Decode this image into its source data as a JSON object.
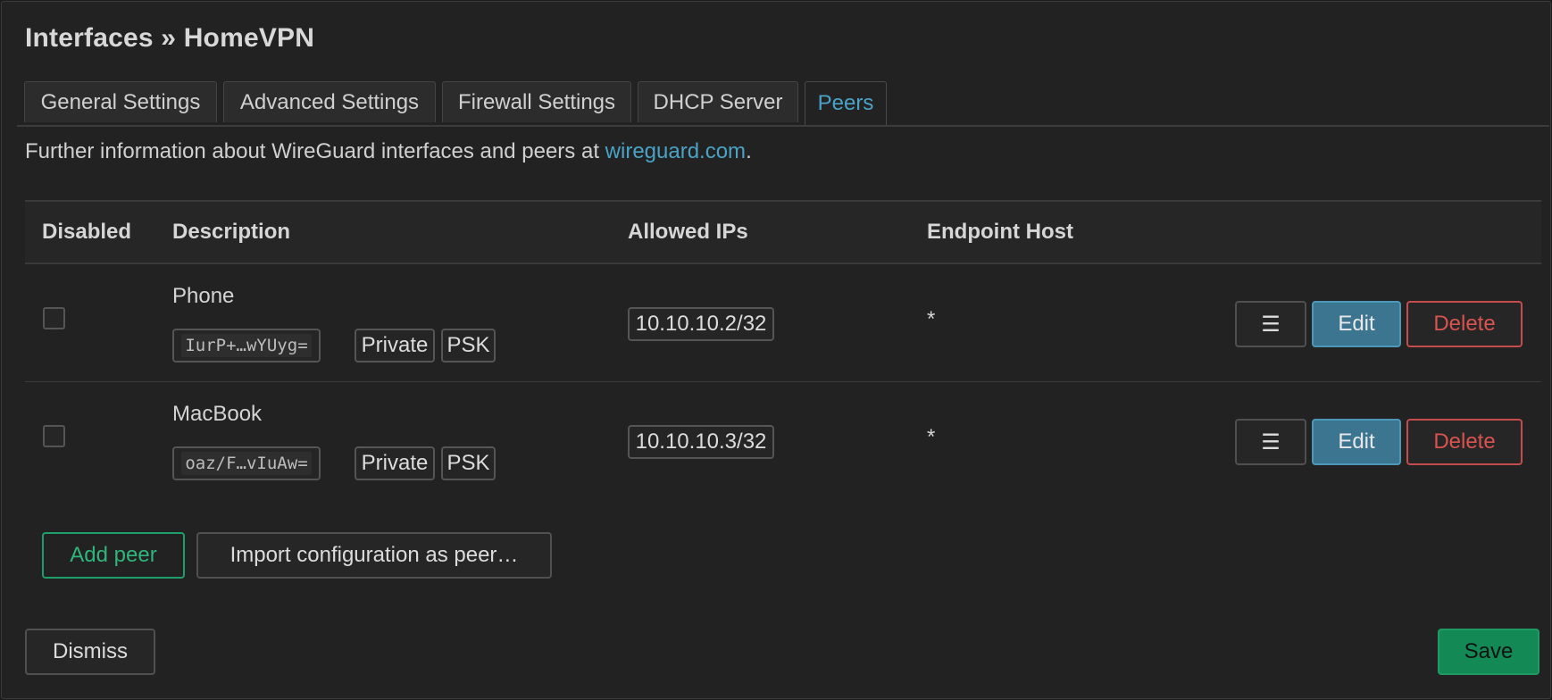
{
  "header": {
    "title": "Interfaces » HomeVPN"
  },
  "tabs": [
    {
      "label": "General Settings",
      "active": false
    },
    {
      "label": "Advanced Settings",
      "active": false
    },
    {
      "label": "Firewall Settings",
      "active": false
    },
    {
      "label": "DHCP Server",
      "active": false
    },
    {
      "label": "Peers",
      "active": true
    }
  ],
  "info": {
    "prefix": "Further information about WireGuard interfaces and peers at ",
    "link_text": "wireguard.com",
    "suffix": "."
  },
  "table": {
    "columns": [
      "Disabled",
      "Description",
      "Allowed IPs",
      "Endpoint Host"
    ],
    "rows": [
      {
        "disabled": false,
        "description": "Phone",
        "public_key": "IurP+…wYUyg=",
        "private_badge": "Private",
        "psk_badge": "PSK",
        "allowed_ips": "10.10.10.2/32",
        "endpoint_host": "*",
        "menu_icon": "☰",
        "edit_label": "Edit",
        "delete_label": "Delete"
      },
      {
        "disabled": false,
        "description": "MacBook",
        "public_key": "oaz/F…vIuAw=",
        "private_badge": "Private",
        "psk_badge": "PSK",
        "allowed_ips": "10.10.10.3/32",
        "endpoint_host": "*",
        "menu_icon": "☰",
        "edit_label": "Edit",
        "delete_label": "Delete"
      }
    ]
  },
  "actions": {
    "add_peer": "Add peer",
    "import_peer": "Import configuration as peer…"
  },
  "footer": {
    "dismiss": "Dismiss",
    "save": "Save"
  },
  "colors": {
    "accent": "#4aa3c7",
    "edit": "#3c7590",
    "delete": "#d9534f",
    "add": "#2fb67c",
    "save": "#138a55"
  }
}
